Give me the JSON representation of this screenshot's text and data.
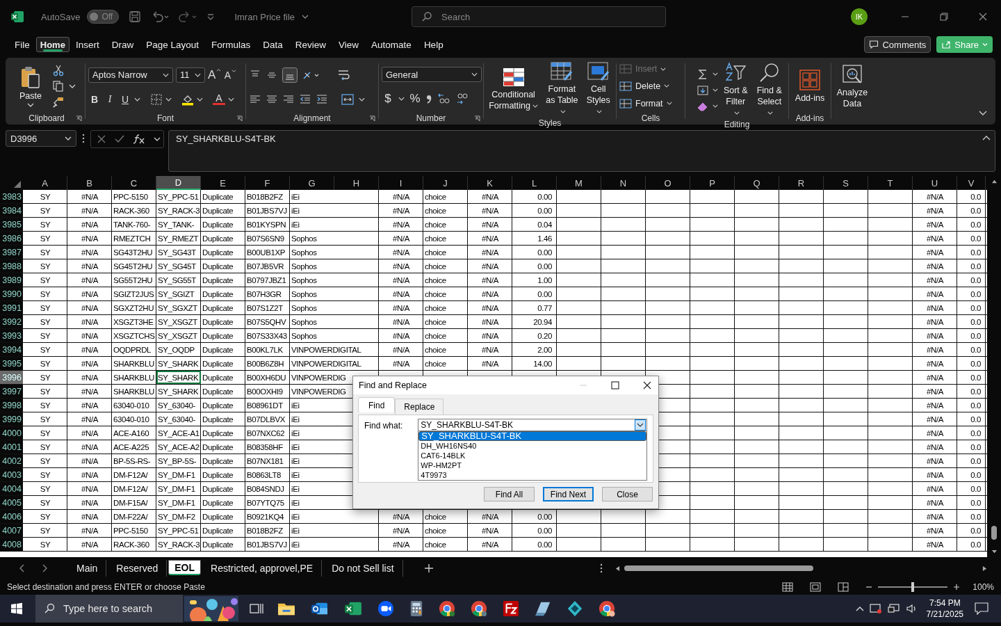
{
  "title_bar": {
    "autosave_label": "AutoSave",
    "autosave": {
      "on": false,
      "label": "Off"
    },
    "file_name": "Imran Price file",
    "search": {
      "placeholder": "Search"
    },
    "avatar": "IK"
  },
  "menu_tabs": [
    {
      "label": "File",
      "selected": false
    },
    {
      "label": "Home",
      "selected": true
    },
    {
      "label": "Insert",
      "selected": false
    },
    {
      "label": "Draw",
      "selected": false
    },
    {
      "label": "Page Layout",
      "selected": false
    },
    {
      "label": "Formulas",
      "selected": false
    },
    {
      "label": "Data",
      "selected": false
    },
    {
      "label": "Review",
      "selected": false
    },
    {
      "label": "View",
      "selected": false
    },
    {
      "label": "Automate",
      "selected": false
    },
    {
      "label": "Help",
      "selected": false
    }
  ],
  "comments_button": "Comments",
  "share_button": "Share",
  "ribbon": {
    "clipboard": {
      "label": "Clipboard",
      "paste": "Paste"
    },
    "font": {
      "label": "Font",
      "family": "Aptos Narrow",
      "size": "11",
      "grow": "A",
      "shrink": "A",
      "bold": "B",
      "italic": "I",
      "underline": "U",
      "font_color": "A"
    },
    "alignment": {
      "label": "Alignment"
    },
    "number": {
      "label": "Number",
      "format": "General",
      "currency": "$",
      "percent": "%"
    },
    "styles": {
      "label": "Styles",
      "buttons": [
        "Conditional Formatting",
        "Format as Table",
        "Cell Styles"
      ]
    },
    "cells": {
      "label": "Cells",
      "buttons": [
        {
          "label": "Insert",
          "disabled": true
        },
        {
          "label": "Delete",
          "disabled": false
        },
        {
          "label": "Format",
          "disabled": false
        }
      ]
    },
    "editing": {
      "label": "Editing",
      "buttons": [
        "Sort & Filter",
        "Find & Select"
      ]
    },
    "addins": {
      "label": "Add-ins",
      "button": "Add-ins"
    },
    "analyze": {
      "button": "Analyze Data"
    }
  },
  "formula_bar": {
    "name_box": "D3996",
    "formula": "SY_SHARKBLU-S4T-BK"
  },
  "grid": {
    "columns": [
      {
        "label": "A",
        "selected": false
      },
      {
        "label": "B",
        "selected": false
      },
      {
        "label": "C",
        "selected": false
      },
      {
        "label": "D",
        "selected": true
      },
      {
        "label": "E",
        "selected": false
      },
      {
        "label": "F",
        "selected": false
      },
      {
        "label": "G",
        "selected": false
      },
      {
        "label": "H",
        "selected": false
      },
      {
        "label": "I",
        "selected": false
      },
      {
        "label": "J",
        "selected": false
      },
      {
        "label": "K",
        "selected": false
      },
      {
        "label": "L",
        "selected": false
      },
      {
        "label": "M",
        "selected": false
      },
      {
        "label": "N",
        "selected": false
      },
      {
        "label": "O",
        "selected": false
      },
      {
        "label": "P",
        "selected": false
      },
      {
        "label": "Q",
        "selected": false
      },
      {
        "label": "R",
        "selected": false
      },
      {
        "label": "S",
        "selected": false
      },
      {
        "label": "T",
        "selected": false
      },
      {
        "label": "U",
        "selected": false
      },
      {
        "label": "V",
        "selected": false
      }
    ],
    "rows": [
      {
        "header": "3983",
        "selected": false,
        "cells": {
          "A": "SY",
          "B": "#N/A",
          "C": "PPC-5150",
          "D": "SY_PPC-51",
          "E": "Duplicate",
          "F": "B018B2FZ",
          "G": "iEi",
          "I": "#N/A",
          "J": "choice",
          "K": "#N/A",
          "L": "0.00",
          "U": "#N/A",
          "V": "0.0"
        }
      },
      {
        "header": "3984",
        "selected": false,
        "cells": {
          "A": "SY",
          "B": "#N/A",
          "C": "RACK-360",
          "D": "SY_RACK-3",
          "E": "Duplicate",
          "F": "B01JBS7VJ",
          "G": "iEi",
          "I": "#N/A",
          "J": "choice",
          "K": "#N/A",
          "L": "0.00",
          "U": "#N/A",
          "V": "0.0"
        }
      },
      {
        "header": "3985",
        "selected": false,
        "cells": {
          "A": "SY",
          "B": "#N/A",
          "C": "TANK-760-",
          "D": "SY_TANK-",
          "E": "Duplicate",
          "F": "B01KYSPN",
          "G": "iEi",
          "I": "#N/A",
          "J": "choice",
          "K": "#N/A",
          "L": "0.04",
          "U": "#N/A",
          "V": "0.0"
        }
      },
      {
        "header": "3986",
        "selected": false,
        "cells": {
          "A": "SY",
          "B": "#N/A",
          "C": "RMEZTCH",
          "D": "SY_RMEZT",
          "E": "Duplicate",
          "F": "B07S6SN9",
          "G": "Sophos",
          "I": "#N/A",
          "J": "choice",
          "K": "#N/A",
          "L": "1.46",
          "U": "#N/A",
          "V": "0.0"
        }
      },
      {
        "header": "3987",
        "selected": false,
        "cells": {
          "A": "SY",
          "B": "#N/A",
          "C": "SG43T2HU",
          "D": "SY_SG43T",
          "E": "Duplicate",
          "F": "B00UB1XP",
          "G": "Sophos",
          "I": "#N/A",
          "J": "choice",
          "K": "#N/A",
          "L": "0.00",
          "U": "#N/A",
          "V": "0.0"
        }
      },
      {
        "header": "3988",
        "selected": false,
        "cells": {
          "A": "SY",
          "B": "#N/A",
          "C": "SG45T2HU",
          "D": "SY_SG45T",
          "E": "Duplicate",
          "F": "B07JB5VR",
          "G": "Sophos",
          "I": "#N/A",
          "J": "choice",
          "K": "#N/A",
          "L": "0.00",
          "U": "#N/A",
          "V": "0.0"
        }
      },
      {
        "header": "3989",
        "selected": false,
        "cells": {
          "A": "SY",
          "B": "#N/A",
          "C": "SG55T2HU",
          "D": "SY_SG55T",
          "E": "Duplicate",
          "F": "B0797JBZ1",
          "G": "Sophos",
          "I": "#N/A",
          "J": "choice",
          "K": "#N/A",
          "L": "1.00",
          "U": "#N/A",
          "V": "0.0"
        }
      },
      {
        "header": "3990",
        "selected": false,
        "cells": {
          "A": "SY",
          "B": "#N/A",
          "C": "SGIZT2JUS",
          "D": "SY_SGIZT",
          "E": "Duplicate",
          "F": "B07H3GR",
          "G": "Sophos",
          "I": "#N/A",
          "J": "choice",
          "K": "#N/A",
          "L": "0.00",
          "U": "#N/A",
          "V": "0.0"
        }
      },
      {
        "header": "3991",
        "selected": false,
        "cells": {
          "A": "SY",
          "B": "#N/A",
          "C": "SGXZT2HU",
          "D": "SY_SGXZT",
          "E": "Duplicate",
          "F": "B07S1Z2T",
          "G": "Sophos",
          "I": "#N/A",
          "J": "choice",
          "K": "#N/A",
          "L": "0.77",
          "U": "#N/A",
          "V": "0.0"
        }
      },
      {
        "header": "3992",
        "selected": false,
        "cells": {
          "A": "SY",
          "B": "#N/A",
          "C": "XSGZT3HE",
          "D": "SY_XSGZT",
          "E": "Duplicate",
          "F": "B07S5QHV",
          "G": "Sophos",
          "I": "#N/A",
          "J": "choice",
          "K": "#N/A",
          "L": "20.94",
          "U": "#N/A",
          "V": "0.0"
        }
      },
      {
        "header": "3993",
        "selected": false,
        "cells": {
          "A": "SY",
          "B": "#N/A",
          "C": "XSGZTCHS",
          "D": "SY_XSGZT",
          "E": "Duplicate",
          "F": "B07S33X43",
          "G": "Sophos",
          "I": "#N/A",
          "J": "choice",
          "K": "#N/A",
          "L": "0.20",
          "U": "#N/A",
          "V": "0.0"
        }
      },
      {
        "header": "3994",
        "selected": false,
        "cells": {
          "A": "SY",
          "B": "#N/A",
          "C": "OQDPRDL",
          "D": "SY_OQDP",
          "E": "Duplicate",
          "F": "B00KL7LK",
          "G": "VINPOWERDIGITAL",
          "I": "#N/A",
          "J": "choice",
          "K": "#N/A",
          "L": "2.00",
          "U": "#N/A",
          "V": "0.0"
        }
      },
      {
        "header": "3995",
        "selected": false,
        "cells": {
          "A": "SY",
          "B": "#N/A",
          "C": "SHARKBLU",
          "D": "SY_SHARK",
          "E": "Duplicate",
          "F": "B00B6Z8H",
          "G": "VINPOWERDIGITAL",
          "I": "#N/A",
          "J": "choice",
          "K": "#N/A",
          "L": "14.00",
          "U": "#N/A",
          "V": "0.0"
        }
      },
      {
        "header": "3996",
        "selected": true,
        "cells": {
          "A": "SY",
          "B": "#N/A",
          "C": "SHARKBLU",
          "D": "SY_SHARK",
          "E": "Duplicate",
          "F": "B00XH6DU",
          "G": "VINPOWERDIG",
          "U": "#N/A",
          "V": "0.0"
        }
      },
      {
        "header": "3997",
        "selected": false,
        "cells": {
          "A": "SY",
          "B": "#N/A",
          "C": "SHARKBLU",
          "D": "SY_SHARK",
          "E": "Duplicate",
          "F": "B00OXHI9",
          "G": "VINPOWERDIG",
          "U": "#N/A",
          "V": "0.0"
        }
      },
      {
        "header": "3998",
        "selected": false,
        "cells": {
          "A": "SY",
          "B": "#N/A",
          "C": "63040-010",
          "D": "SY_63040-",
          "E": "Duplicate",
          "F": "B08961DT",
          "G": "iEi",
          "U": "#N/A",
          "V": "0.0"
        }
      },
      {
        "header": "3999",
        "selected": false,
        "cells": {
          "A": "SY",
          "B": "#N/A",
          "C": "63040-010",
          "D": "SY_63040-",
          "E": "Duplicate",
          "F": "B07DLBVX",
          "G": "iEi",
          "U": "#N/A",
          "V": "0.0"
        }
      },
      {
        "header": "4000",
        "selected": false,
        "cells": {
          "A": "SY",
          "B": "#N/A",
          "C": "ACE-A160",
          "D": "SY_ACE-A1",
          "E": "Duplicate",
          "F": "B07NXC62",
          "G": "iEi",
          "U": "#N/A",
          "V": "0.0"
        }
      },
      {
        "header": "4001",
        "selected": false,
        "cells": {
          "A": "SY",
          "B": "#N/A",
          "C": "ACE-A225",
          "D": "SY_ACE-A2",
          "E": "Duplicate",
          "F": "B08358HF",
          "G": "iEi",
          "U": "#N/A",
          "V": "0.0"
        }
      },
      {
        "header": "4002",
        "selected": false,
        "cells": {
          "A": "SY",
          "B": "#N/A",
          "C": "BP-5S-RS-",
          "D": "SY_BP-5S-",
          "E": "Duplicate",
          "F": "B07NX181",
          "G": "iEi",
          "U": "#N/A",
          "V": "0.0"
        }
      },
      {
        "header": "4003",
        "selected": false,
        "cells": {
          "A": "SY",
          "B": "#N/A",
          "C": "DM-F12A/",
          "D": "SY_DM-F1",
          "E": "Duplicate",
          "F": "B0863LT8",
          "G": "iEi",
          "U": "#N/A",
          "V": "0.0"
        }
      },
      {
        "header": "4004",
        "selected": false,
        "cells": {
          "A": "SY",
          "B": "#N/A",
          "C": "DM-F12A/",
          "D": "SY_DM-F1",
          "E": "Duplicate",
          "F": "B084SNDJ",
          "G": "iEi",
          "U": "#N/A",
          "V": "0.0"
        }
      },
      {
        "header": "4005",
        "selected": false,
        "cells": {
          "A": "SY",
          "B": "#N/A",
          "C": "DM-F15A/",
          "D": "SY_DM-F1",
          "E": "Duplicate",
          "F": "B07YTQ75",
          "G": "iEi",
          "U": "#N/A",
          "V": "0.0"
        }
      },
      {
        "header": "4006",
        "selected": false,
        "cells": {
          "A": "SY",
          "B": "#N/A",
          "C": "DM-F22A/",
          "D": "SY_DM-F2",
          "E": "Duplicate",
          "F": "B0921KQ4",
          "G": "iEi",
          "I": "#N/A",
          "J": "choice",
          "K": "#N/A",
          "L": "0.00",
          "U": "#N/A",
          "V": "0.0"
        }
      },
      {
        "header": "4007",
        "selected": false,
        "cells": {
          "A": "SY",
          "B": "#N/A",
          "C": "PPC-5150",
          "D": "SY_PPC-51",
          "E": "Duplicate",
          "F": "B018B2FZ",
          "G": "iEi",
          "I": "#N/A",
          "J": "choice",
          "K": "#N/A",
          "L": "0.00",
          "U": "#N/A",
          "V": "0.0"
        }
      },
      {
        "header": "4008",
        "selected": false,
        "cells": {
          "A": "SY",
          "B": "#N/A",
          "C": "RACK-360",
          "D": "SY_RACK-3",
          "E": "Duplicate",
          "F": "B01JBS7VJ",
          "G": "iEi",
          "I": "#N/A",
          "J": "choice",
          "K": "#N/A",
          "L": "0.00",
          "U": "#N/A",
          "V": "0.0"
        }
      }
    ]
  },
  "dialog": {
    "title": "Find and Replace",
    "tabs": [
      {
        "label": "Find",
        "selected": true
      },
      {
        "label": "Replace",
        "selected": false
      }
    ],
    "find_what_label": "Find what:",
    "find_what": "SY_SHARKBLU-S4T-BK",
    "history": [
      {
        "text": "SY_SHARKBLU-S4T-BK",
        "selected": true
      },
      {
        "text": "DH_WH16NS40",
        "selected": false
      },
      {
        "text": "CAT6-14BLK",
        "selected": false
      },
      {
        "text": "WP-HM2PT",
        "selected": false
      },
      {
        "text": "4T9973",
        "selected": false
      }
    ],
    "buttons": [
      {
        "label": "Find All",
        "default": false
      },
      {
        "label": "Find Next",
        "default": true
      },
      {
        "label": "Close",
        "default": false
      }
    ]
  },
  "sheet_tabs": [
    {
      "label": "Main",
      "selected": false
    },
    {
      "label": "Reserved",
      "selected": false
    },
    {
      "label": "EOL",
      "selected": true
    },
    {
      "label": "Restricted, approvel,PE",
      "selected": false
    },
    {
      "label": "Do not Sell list",
      "selected": false
    }
  ],
  "status_bar": {
    "message": "Select destination and press ENTER or choose Paste",
    "zoom": {
      "level": 0.5
    },
    "zoom_label": "100%"
  },
  "taskbar": {
    "search": {
      "placeholder": "Type here to search"
    },
    "time": "7:54 PM",
    "date": "7/21/2025"
  }
}
